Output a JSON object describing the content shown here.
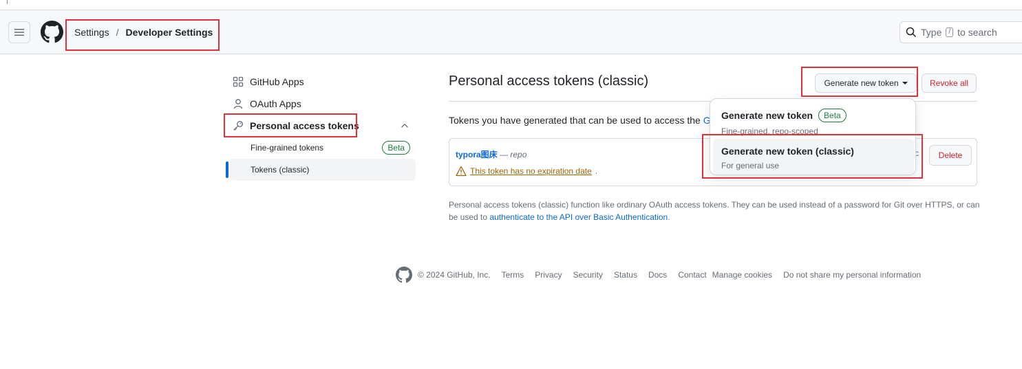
{
  "header": {
    "breadcrumb": [
      "Settings",
      "/",
      "Developer Settings"
    ],
    "search_prefix": "Type",
    "search_key": "/",
    "search_suffix": "to search"
  },
  "sidebar": {
    "items": [
      {
        "label": "GitHub Apps",
        "icon": "apps-icon"
      },
      {
        "label": "OAuth Apps",
        "icon": "person-icon"
      },
      {
        "label": "Personal access tokens",
        "icon": "key-icon"
      }
    ],
    "sub_items": [
      {
        "label": "Fine-grained tokens",
        "badge": "Beta"
      },
      {
        "label": "Tokens (classic)"
      }
    ]
  },
  "main": {
    "title": "Personal access tokens (classic)",
    "generate_button": "Generate new token",
    "revoke_button": "Revoke all",
    "description": "Tokens you have generated that can be used to access the",
    "description_link": "Git",
    "token": {
      "name": "typora图床",
      "separator": "—",
      "scope": "repo",
      "warning": "This token has no expiration date",
      "warning_suffix": ".",
      "truncated": "c",
      "delete_button": "Delete"
    },
    "note_text": "Personal access tokens (classic) function like ordinary OAuth access tokens. They can be used instead of a password for Git over HTTPS, or can be used to",
    "note_link": "authenticate to the API over Basic Authentication",
    "note_suffix": "."
  },
  "dropdown": {
    "items": [
      {
        "title": "Generate new token",
        "badge": "Beta",
        "subtitle": "Fine-grained, repo-scoped"
      },
      {
        "title": "Generate new token (classic)",
        "subtitle": "For general use"
      }
    ]
  },
  "footer": {
    "copyright": "© 2024 GitHub, Inc.",
    "links": [
      "Terms",
      "Privacy",
      "Security",
      "Status",
      "Docs",
      "Contact",
      "Manage cookies",
      "Do not share my personal information"
    ]
  },
  "colors": {
    "accent": "#0969da",
    "danger": "#cf222e",
    "success": "#1a7f37",
    "warning": "#9a6700",
    "highlight_box": "#e5303b"
  }
}
